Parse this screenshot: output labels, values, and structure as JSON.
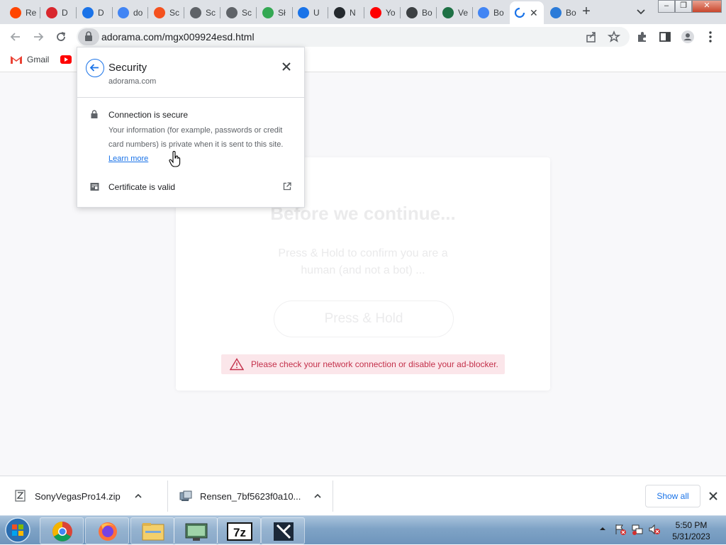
{
  "tabs": [
    {
      "label": "Re",
      "icon": "reddit-icon",
      "color": "#ff4500"
    },
    {
      "label": "D",
      "icon": "mega-icon",
      "color": "#d9272e"
    },
    {
      "label": "D",
      "icon": "download-icon",
      "color": "#1a73e8"
    },
    {
      "label": "do",
      "icon": "google-icon",
      "color": "#4285f4"
    },
    {
      "label": "Sc",
      "icon": "upload-orange-icon",
      "color": "#f4511e"
    },
    {
      "label": "Sc",
      "icon": "globe-icon",
      "color": "#5f6368"
    },
    {
      "label": "Sc",
      "icon": "globe-icon",
      "color": "#5f6368"
    },
    {
      "label": "Sł",
      "icon": "share-green-icon",
      "color": "#34a853"
    },
    {
      "label": "U",
      "icon": "upload-blue-icon",
      "color": "#1a73e8"
    },
    {
      "label": "N",
      "icon": "github-icon",
      "color": "#24292e"
    },
    {
      "label": "Yo",
      "icon": "youtube-icon",
      "color": "#ff0000"
    },
    {
      "label": "Bo",
      "icon": "tool-icon",
      "color": "#3c4043"
    },
    {
      "label": "Ve",
      "icon": "excel-icon",
      "color": "#1e7145"
    },
    {
      "label": "Bo",
      "icon": "google-icon",
      "color": "#4285f4"
    },
    {
      "label": "",
      "icon": "loading-icon",
      "color": "#1a73e8",
      "active": true
    },
    {
      "label": "Bo",
      "icon": "shield-blue-icon",
      "color": "#2b7bd8"
    }
  ],
  "toolbar": {
    "url": "adorama.com/mgx009924esd.html"
  },
  "bookmarks": [
    {
      "label": "Gmail",
      "icon": "gmail-icon"
    },
    {
      "label": "",
      "icon": "youtube-icon"
    }
  ],
  "security_popup": {
    "title": "Security",
    "domain": "adorama.com",
    "connection_title": "Connection is secure",
    "connection_desc": "Your information (for example, passwords or credit card numbers) is private when it is sent to this site.",
    "learn_more": "Learn more",
    "certificate": "Certificate is valid"
  },
  "page": {
    "card_title": "Before we continue...",
    "card_subtitle": "Press & Hold to confirm you are a human (and not a bot) ...",
    "hold_button": "Press & Hold",
    "warning": "Please check your network connection or disable your ad-blocker."
  },
  "downloads": {
    "items": [
      {
        "name": "SonyVegasPro14.zip",
        "icon": "zip-icon"
      },
      {
        "name": "Rensen_7bf5623f0a10...",
        "icon": "installer-icon"
      }
    ],
    "show_all": "Show all"
  },
  "taskbar": {
    "apps": [
      "chrome-icon",
      "firefox-icon",
      "file-explorer-icon",
      "monitor-icon",
      "7zip-icon",
      "video-editor-icon"
    ],
    "time": "5:50 PM",
    "date": "5/31/2023"
  },
  "colors": {
    "accent": "#1a73e8",
    "warning_bg": "#fbe6ea",
    "warning_text": "#c4314b"
  }
}
